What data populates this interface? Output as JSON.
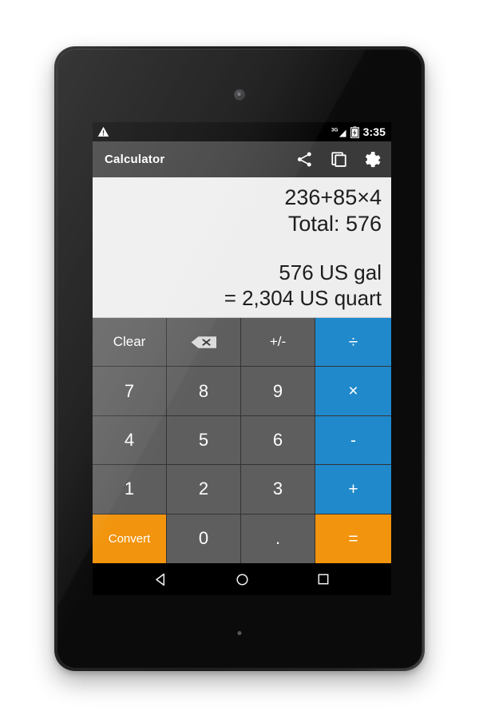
{
  "status_bar": {
    "warning_icon": "warning-triangle-icon",
    "network_label": "3G",
    "signal_icon": "signal-bars-icon",
    "battery_icon": "battery-charging-icon",
    "clock": "3:35"
  },
  "toolbar": {
    "title": "Calculator",
    "actions": [
      {
        "name": "share-icon",
        "label": "Share"
      },
      {
        "name": "copy-icon",
        "label": "Copy"
      },
      {
        "name": "settings-gear-icon",
        "label": "Settings"
      }
    ]
  },
  "display": {
    "expression": "236+85×4",
    "total": "Total: 576",
    "convert_from": "576 US gal",
    "convert_to": "= 2,304 US quart"
  },
  "keypad": {
    "rows": [
      [
        {
          "label": "Clear",
          "name": "key-clear",
          "kind": "func"
        },
        {
          "label": "",
          "name": "key-backspace",
          "kind": "backspace"
        },
        {
          "label": "+/-",
          "name": "key-sign",
          "kind": "func"
        },
        {
          "label": "÷",
          "name": "key-divide",
          "kind": "op"
        }
      ],
      [
        {
          "label": "7",
          "name": "key-7",
          "kind": "num"
        },
        {
          "label": "8",
          "name": "key-8",
          "kind": "num"
        },
        {
          "label": "9",
          "name": "key-9",
          "kind": "num"
        },
        {
          "label": "×",
          "name": "key-multiply",
          "kind": "op"
        }
      ],
      [
        {
          "label": "4",
          "name": "key-4",
          "kind": "num"
        },
        {
          "label": "5",
          "name": "key-5",
          "kind": "num"
        },
        {
          "label": "6",
          "name": "key-6",
          "kind": "num"
        },
        {
          "label": "-",
          "name": "key-minus",
          "kind": "op"
        }
      ],
      [
        {
          "label": "1",
          "name": "key-1",
          "kind": "num"
        },
        {
          "label": "2",
          "name": "key-2",
          "kind": "num"
        },
        {
          "label": "3",
          "name": "key-3",
          "kind": "num"
        },
        {
          "label": "+",
          "name": "key-plus",
          "kind": "op"
        }
      ],
      [
        {
          "label": "Convert",
          "name": "key-convert",
          "kind": "convert"
        },
        {
          "label": "0",
          "name": "key-0",
          "kind": "num"
        },
        {
          "label": ".",
          "name": "key-decimal",
          "kind": "dot"
        },
        {
          "label": "=",
          "name": "key-equals",
          "kind": "equals"
        }
      ]
    ]
  },
  "nav_bar": {
    "back": "back-triangle-icon",
    "home": "home-circle-icon",
    "recents": "recents-square-icon"
  },
  "colors": {
    "operator_blue": "#2089cc",
    "accent_orange": "#f2940d",
    "key_gray": "#5e5e5e",
    "toolbar_gray": "#3a3a3a",
    "display_bg": "#eeeeee"
  }
}
